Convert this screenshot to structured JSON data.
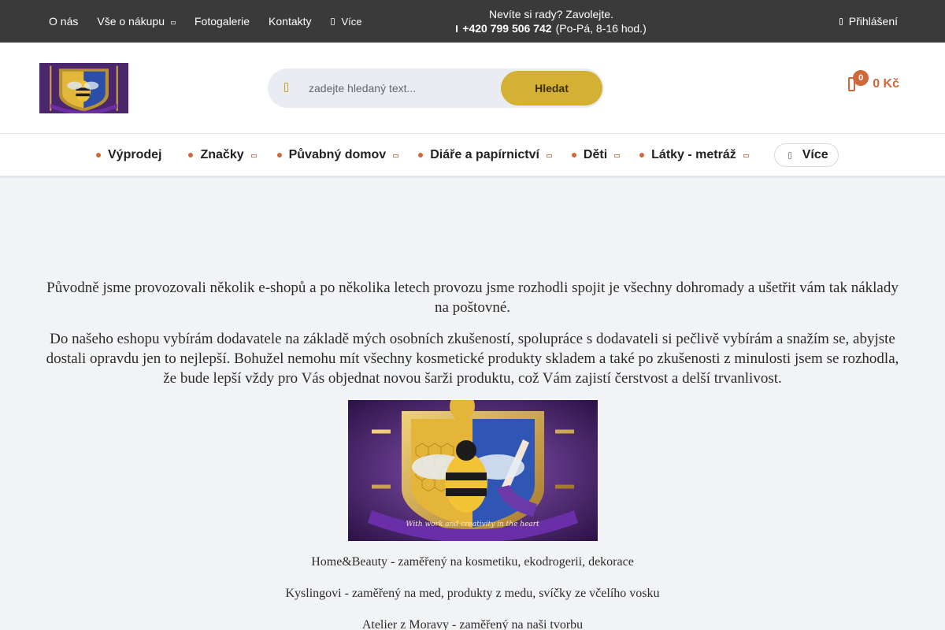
{
  "topbar": {
    "nav": [
      {
        "label": "O nás"
      },
      {
        "label": "Vše o nákupu"
      },
      {
        "label": "Fotogalerie"
      },
      {
        "label": "Kontakty"
      }
    ],
    "more_label": "Více",
    "help_text": "Nevíte si rady? Zavolejte.",
    "phone": "+420 799 506 742",
    "hours": "(Po-Pá, 8-16 hod.)",
    "login_label": "Přihlášení"
  },
  "logo": {
    "motto": "With work and creativity in the heart"
  },
  "search": {
    "placeholder": "zadejte hledaný text...",
    "button_label": "Hledat"
  },
  "cart": {
    "count": "0",
    "total": "0 Kč"
  },
  "categories": [
    {
      "label": "Výprodej",
      "has_submenu": false
    },
    {
      "label": "Značky",
      "has_submenu": true
    },
    {
      "label": "Půvabný domov",
      "has_submenu": true
    },
    {
      "label": "Diáře a papírnictví",
      "has_submenu": true
    },
    {
      "label": "Děti",
      "has_submenu": true
    },
    {
      "label": "Látky - metráž",
      "has_submenu": true
    }
  ],
  "category_more_label": "Více",
  "content": {
    "paragraph1": "Původně jsme provozovali několik e-shopů a po několika letech provozu jsme rozhodli spojit je všechny dohromady a ušetřit vám tak náklady na poštovné.",
    "paragraph2": "Do našeho eshopu vybírám dodavatele na základě mých osobních zkušeností, spolupráce s dodavateli si pečlivě vybírám a snažím se, abyjste dostali opravdu jen to nejlepší. Bohužel nemohu mít všechny kosmetické produkty skladem a také po zkušenosti z minulosti jsem se rozhodla, že bude lepší vždy pro Vás objednat novou šarži produktu, což Vám zajistí čerstvost a delší trvanlivost.",
    "crest_motto": "With work and creativity in the heart",
    "shops": [
      "Home&Beauty - zaměřený na kosmetiku, ekodrogerii, dekorace",
      "Kyslingovi - zaměřený na med, produkty z medu, svíčky ze včelího vosku",
      "Atelier z Moravy - zaměřený na naši tvorbu"
    ]
  },
  "colors": {
    "topbar_bg": "#3a3a3a",
    "accent_gold": "#d4b035",
    "accent_orange": "#d0683a",
    "crest_purple": "#3d1d5e"
  }
}
